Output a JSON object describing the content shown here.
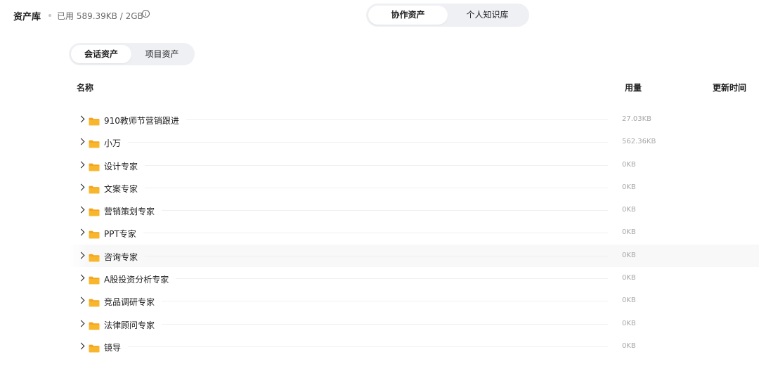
{
  "header": {
    "title": "资产库",
    "usage": "已用 589.39KB / 2GB",
    "info_icon": "info-icon"
  },
  "top_tabs": [
    {
      "label": "协作资产",
      "active": true
    },
    {
      "label": "个人知识库",
      "active": false
    }
  ],
  "sub_tabs": [
    {
      "label": "会话资产",
      "active": true
    },
    {
      "label": "项目资产",
      "active": false
    }
  ],
  "table": {
    "columns": {
      "name": "名称",
      "size": "用量",
      "updated": "更新时间"
    },
    "rows": [
      {
        "name": "910教师节营销跟进",
        "size": "27.03KB"
      },
      {
        "name": "小万",
        "size": "562.36KB"
      },
      {
        "name": "设计专家",
        "size": "0KB"
      },
      {
        "name": "文案专家",
        "size": "0KB"
      },
      {
        "name": "营销策划专家",
        "size": "0KB"
      },
      {
        "name": "PPT专家",
        "size": "0KB"
      },
      {
        "name": "咨询专家",
        "size": "0KB"
      },
      {
        "name": "A股投资分析专家",
        "size": "0KB"
      },
      {
        "name": "竞品调研专家",
        "size": "0KB"
      },
      {
        "name": "法律顾问专家",
        "size": "0KB"
      },
      {
        "name": "镜导",
        "size": "0KB"
      }
    ]
  },
  "colors": {
    "folder": "#f8b62d",
    "folder_tab": "#f4a41d",
    "segment_bg": "#eef0f4",
    "muted_text": "#a8a8a8"
  }
}
